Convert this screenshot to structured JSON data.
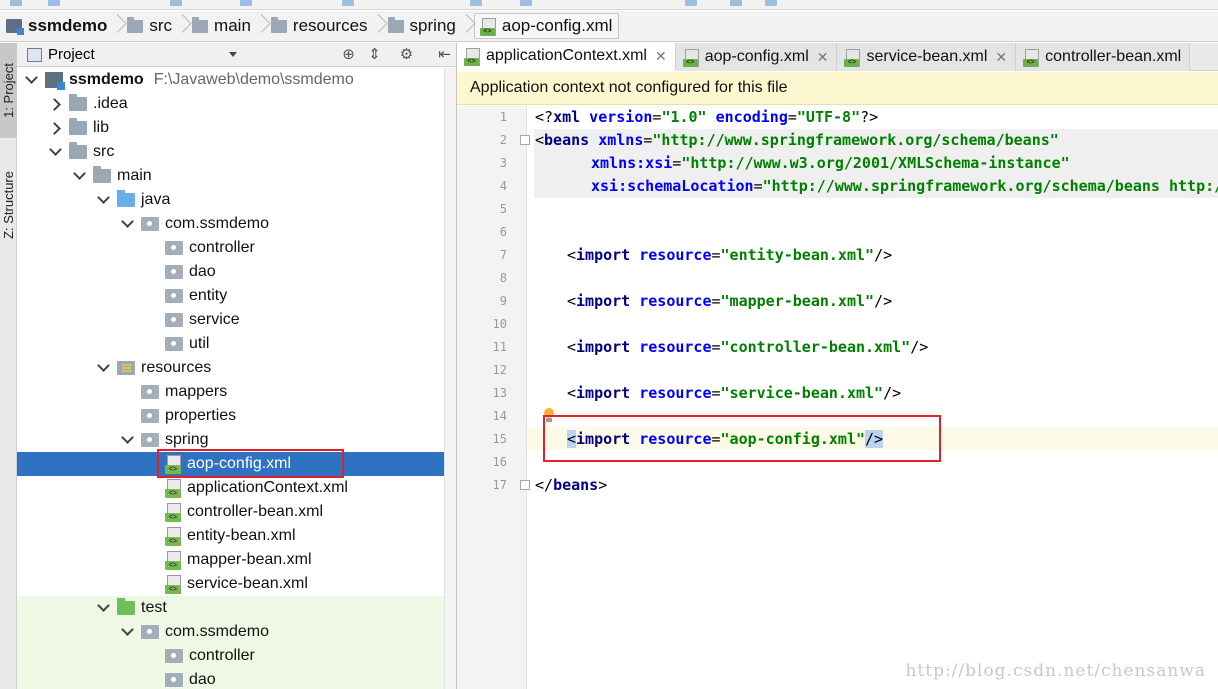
{
  "breadcrumb": {
    "items": [
      "ssmdemo",
      "src",
      "main",
      "resources",
      "spring",
      "aop-config.xml"
    ]
  },
  "tool_strip": {
    "project_tab": "1: Project",
    "structure_tab": "Z: Structure"
  },
  "project_panel": {
    "title": "Project",
    "tree": [
      {
        "label": "ssmdemo",
        "path": "F:\\Javaweb\\demo\\ssmdemo"
      },
      {
        "label": ".idea"
      },
      {
        "label": "lib"
      },
      {
        "label": "src"
      },
      {
        "label": "main"
      },
      {
        "label": "java"
      },
      {
        "label": "com.ssmdemo"
      },
      {
        "label": "controller"
      },
      {
        "label": "dao"
      },
      {
        "label": "entity"
      },
      {
        "label": "service"
      },
      {
        "label": "util"
      },
      {
        "label": "resources"
      },
      {
        "label": "mappers"
      },
      {
        "label": "properties"
      },
      {
        "label": "spring"
      },
      {
        "label": "aop-config.xml"
      },
      {
        "label": "applicationContext.xml"
      },
      {
        "label": "controller-bean.xml"
      },
      {
        "label": "entity-bean.xml"
      },
      {
        "label": "mapper-bean.xml"
      },
      {
        "label": "service-bean.xml"
      },
      {
        "label": "test"
      },
      {
        "label": "com.ssmdemo"
      },
      {
        "label": "controller"
      },
      {
        "label": "dao"
      }
    ]
  },
  "editor": {
    "tabs": [
      {
        "label": "applicationContext.xml",
        "active": true
      },
      {
        "label": "aop-config.xml"
      },
      {
        "label": "service-bean.xml"
      },
      {
        "label": "controller-bean.xml"
      }
    ],
    "banner": "Application context not configured for this file",
    "line_numbers": [
      "1",
      "2",
      "3",
      "4",
      "5",
      "6",
      "7",
      "8",
      "9",
      "10",
      "11",
      "12",
      "13",
      "14",
      "15",
      "16",
      "17"
    ],
    "code": {
      "l1": {
        "open": "<?",
        "tag": "xml",
        "a1": " version",
        "eq1": "=",
        "v1": "\"1.0\"",
        "a2": " encoding",
        "eq2": "=",
        "v2": "\"UTF-8\"",
        "close": "?>"
      },
      "l2": {
        "open": "<",
        "tag": "beans",
        "a1": " xmlns",
        "eq1": "=",
        "v1": "\"http://www.springframework.org/schema/beans\""
      },
      "l3": {
        "a1": "xmlns:xsi",
        "eq1": "=",
        "v1": "\"http://www.w3.org/2001/XMLSchema-instance\""
      },
      "l4": {
        "a1": "xsi:schemaLocation",
        "eq1": "=",
        "v1": "\"http://www.springframework.org/schema/beans http:/"
      },
      "imports": [
        {
          "value": "\"entity-bean.xml\""
        },
        {
          "value": "\"mapper-bean.xml\""
        },
        {
          "value": "\"controller-bean.xml\""
        },
        {
          "value": "\"service-bean.xml\""
        },
        {
          "value": "\"aop-config.xml\""
        }
      ],
      "import_tag": "import",
      "import_attr": " resource",
      "lt": "<",
      "eq": "=",
      "selfclose": "/>",
      "end_open": "</",
      "end_tag": "beans",
      "end_close": ">"
    }
  },
  "watermark": "http://blog.csdn.net/chensanwa"
}
